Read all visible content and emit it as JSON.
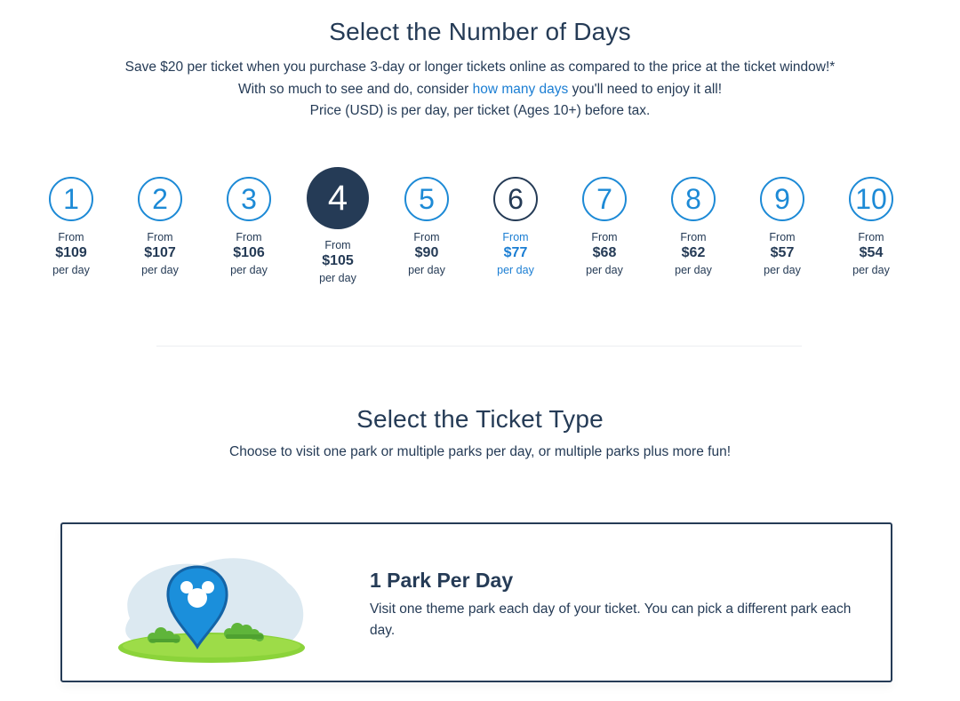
{
  "days_section": {
    "title": "Select the Number of Days",
    "intro_line1_pre": "Save $20 per ticket when you purchase 3-day or longer tickets online as compared to the price at the ticket window!* With so much to see and do, consider ",
    "intro_link": "how many days",
    "intro_line1_post": " you'll need to enjoy it all!",
    "intro_line2": "Price (USD) is per day, per ticket (Ages 10+) before tax.",
    "selected_day": "4",
    "options": [
      {
        "days": "1",
        "from": "From",
        "price": "$109",
        "per": "per day"
      },
      {
        "days": "2",
        "from": "From",
        "price": "$107",
        "per": "per day"
      },
      {
        "days": "3",
        "from": "From",
        "price": "$106",
        "per": "per day"
      },
      {
        "days": "4",
        "from": "From",
        "price": "$105",
        "per": "per day"
      },
      {
        "days": "5",
        "from": "From",
        "price": "$90",
        "per": "per day"
      },
      {
        "days": "6",
        "from": "From",
        "price": "$77",
        "per": "per day"
      },
      {
        "days": "7",
        "from": "From",
        "price": "$68",
        "per": "per day"
      },
      {
        "days": "8",
        "from": "From",
        "price": "$62",
        "per": "per day"
      },
      {
        "days": "9",
        "from": "From",
        "price": "$57",
        "per": "per day"
      },
      {
        "days": "10",
        "from": "From",
        "price": "$54",
        "per": "per day"
      }
    ]
  },
  "ticket_section": {
    "title": "Select the Ticket Type",
    "subtitle": "Choose to visit one park or multiple parks per day, or multiple parks plus more fun!",
    "card": {
      "title": "1 Park Per Day",
      "description": "Visit one theme park each day of your ticket. You can pick a different park each day.",
      "icon": "location-pin-icon"
    }
  },
  "colors": {
    "navy": "#253b56",
    "accent_blue": "#1d8ad6",
    "link_blue": "#1b7ed3"
  }
}
